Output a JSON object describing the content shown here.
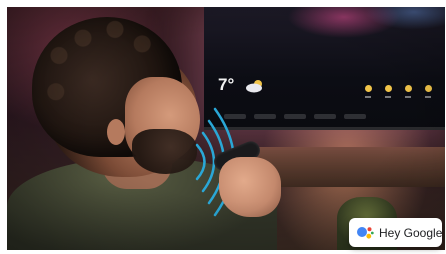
{
  "scene": {
    "description_tag": "man-holding-remote-near-tv",
    "accent_colors": {
      "sound_waves": "#2aa7d6",
      "assistant_blue": "#4285F4",
      "assistant_red": "#EA4335",
      "assistant_yellow": "#FBBC05",
      "assistant_green": "#34A853"
    }
  },
  "tv": {
    "temperature": "7°"
  },
  "badge": {
    "label": "Hey Google",
    "icon": "google-assistant-icon"
  }
}
